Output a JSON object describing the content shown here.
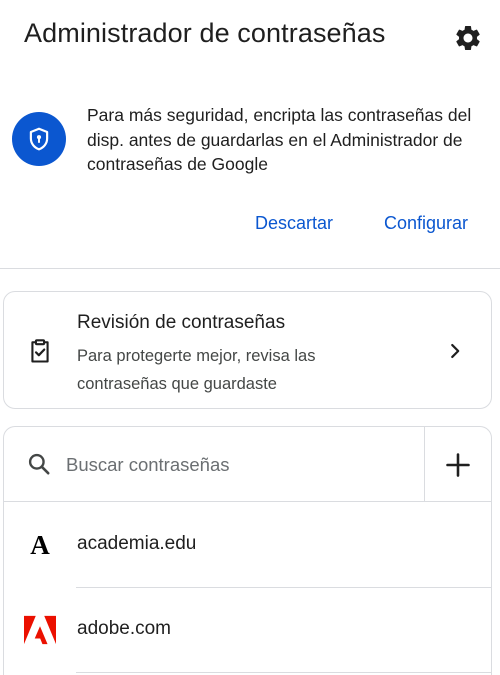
{
  "header": {
    "title": "Administrador de contraseñas",
    "settings_icon": "gear-icon"
  },
  "banner": {
    "icon": "shield-lock-icon",
    "text": "Para más seguridad, encripta las contraseñas del disp. antes de guardarlas en el Administrador de contraseñas de Google",
    "dismiss_label": "Descartar",
    "configure_label": "Configurar"
  },
  "checkup": {
    "icon": "clipboard-check-icon",
    "title": "Revisión de contraseñas",
    "subtitle": "Para protegerte mejor, revisa las contraseñas que guardaste"
  },
  "search": {
    "placeholder": "Buscar contraseñas",
    "value": ""
  },
  "passwords": [
    {
      "site": "academia.edu",
      "icon": "academia-logo-icon"
    },
    {
      "site": "adobe.com",
      "icon": "adobe-logo-icon"
    }
  ],
  "colors": {
    "accent": "#0b57d0",
    "text_primary": "#1f1f1f",
    "text_secondary": "#444746",
    "divider": "#dadce0",
    "adobe_red": "#eb1000"
  }
}
